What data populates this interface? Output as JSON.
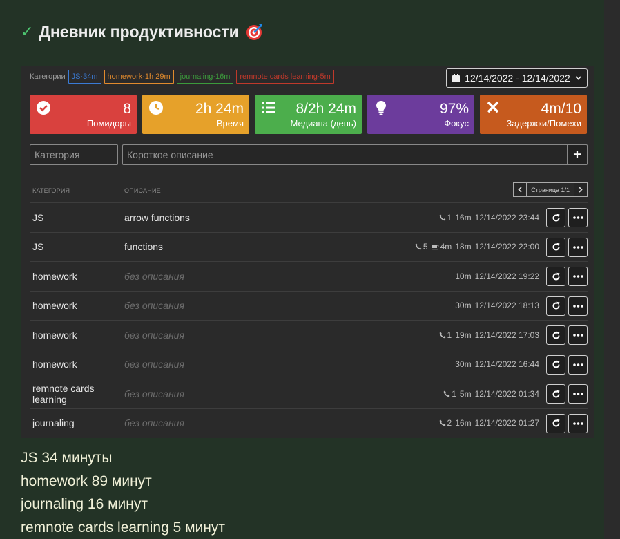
{
  "page": {
    "title": "Дневник продуктивности"
  },
  "categories_bar": {
    "label": "Категории",
    "chips": [
      {
        "name": "JS",
        "time": "34m",
        "text": "JS·34m",
        "color": "#3a7bd5"
      },
      {
        "name": "homework",
        "time": "1h 29m",
        "text": "homework·1h 29m",
        "color": "#e08a2d"
      },
      {
        "name": "journaling",
        "time": "16m",
        "text": "journaling·16m",
        "color": "#3c9a3c"
      },
      {
        "name": "remnote cards learning",
        "time": "5m",
        "text": "remnote cards learning·5m",
        "color": "#c0392b"
      }
    ]
  },
  "date_range": {
    "label": "12/14/2022 - 12/14/2022"
  },
  "stats": [
    {
      "value": "8",
      "label": "Помидоры",
      "color": "#d9413e",
      "icon": "check-circle-icon"
    },
    {
      "value": "2h 24m",
      "label": "Время",
      "color": "#e6a12a",
      "icon": "clock-icon"
    },
    {
      "value": "8/2h 24m",
      "label": "Медиана (день)",
      "color": "#4cae4c",
      "icon": "list-icon"
    },
    {
      "value": "97%",
      "label": "Фокус",
      "color": "#6c3c9c",
      "icon": "lightbulb-icon"
    },
    {
      "value": "4m/10",
      "label": "Задержки/Помехи",
      "color": "#c65a1e",
      "icon": "times-icon"
    }
  ],
  "form": {
    "category_placeholder": "Категория",
    "description_placeholder": "Короткое описание",
    "add_label": "+"
  },
  "table": {
    "col_category": "КАТЕГОРИЯ",
    "col_description": "ОПИСАНИЕ",
    "pagination": "Страница 1/1",
    "rows": [
      {
        "category": "JS",
        "description": "arrow functions",
        "calls": "1",
        "breaks": "",
        "duration": "16m",
        "datetime": "12/14/2022 23:44"
      },
      {
        "category": "JS",
        "description": "functions",
        "calls": "5",
        "breaks": "4m",
        "duration": "18m",
        "datetime": "12/14/2022 22:00"
      },
      {
        "category": "homework",
        "description": "без описания",
        "calls": "",
        "breaks": "",
        "duration": "10m",
        "datetime": "12/14/2022 19:22"
      },
      {
        "category": "homework",
        "description": "без описания",
        "calls": "",
        "breaks": "",
        "duration": "30m",
        "datetime": "12/14/2022 18:13"
      },
      {
        "category": "homework",
        "description": "без описания",
        "calls": "1",
        "breaks": "",
        "duration": "19m",
        "datetime": "12/14/2022 17:03"
      },
      {
        "category": "homework",
        "description": "без описания",
        "calls": "",
        "breaks": "",
        "duration": "30m",
        "datetime": "12/14/2022 16:44"
      },
      {
        "category": "remnote cards learning",
        "description": "без описания",
        "calls": "1",
        "breaks": "",
        "duration": "5m",
        "datetime": "12/14/2022 01:34"
      },
      {
        "category": "journaling",
        "description": "без описания",
        "calls": "2",
        "breaks": "",
        "duration": "16m",
        "datetime": "12/14/2022 01:27"
      }
    ]
  },
  "summary": [
    "JS 34 минуты",
    "homework 89 минут",
    "journaling 16 минут",
    "remnote cards learning 5 минут"
  ]
}
